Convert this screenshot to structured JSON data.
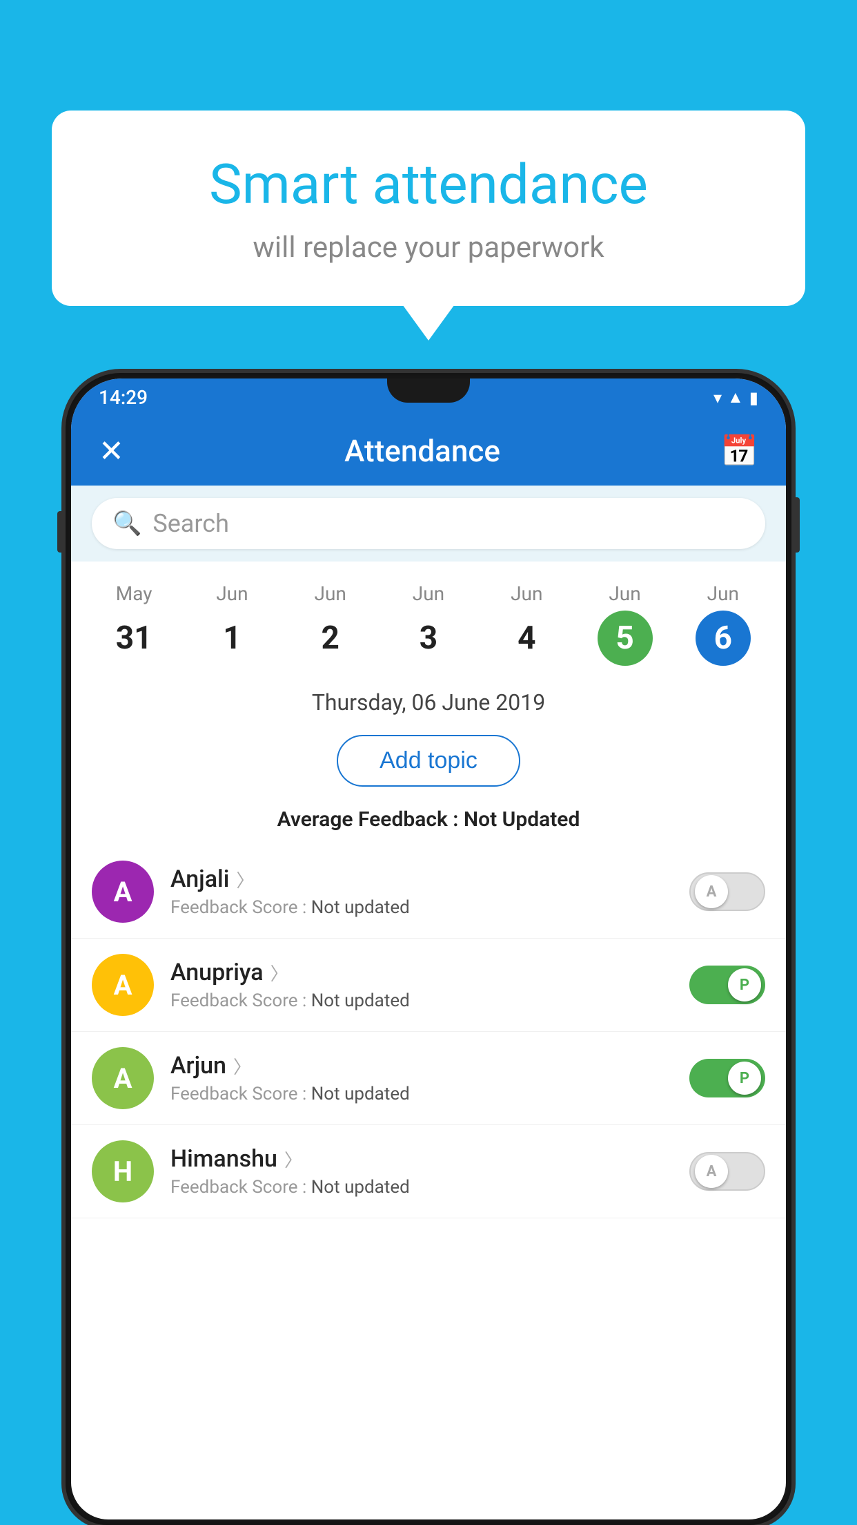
{
  "background_color": "#1ab6e8",
  "bubble": {
    "title": "Smart attendance",
    "subtitle": "will replace your paperwork"
  },
  "status_bar": {
    "time": "14:29"
  },
  "app_bar": {
    "title": "Attendance",
    "close_icon": "✕",
    "calendar_icon": "📅"
  },
  "search": {
    "placeholder": "Search"
  },
  "calendar": {
    "days": [
      {
        "month": "May",
        "num": "31",
        "state": "normal"
      },
      {
        "month": "Jun",
        "num": "1",
        "state": "normal"
      },
      {
        "month": "Jun",
        "num": "2",
        "state": "normal"
      },
      {
        "month": "Jun",
        "num": "3",
        "state": "normal"
      },
      {
        "month": "Jun",
        "num": "4",
        "state": "normal"
      },
      {
        "month": "Jun",
        "num": "5",
        "state": "today"
      },
      {
        "month": "Jun",
        "num": "6",
        "state": "selected"
      }
    ]
  },
  "selected_date": "Thursday, 06 June 2019",
  "add_topic_label": "Add topic",
  "average_feedback": {
    "label": "Average Feedback : ",
    "value": "Not Updated"
  },
  "students": [
    {
      "name": "Anjali",
      "avatar_letter": "A",
      "avatar_color": "#9c27b0",
      "feedback": "Not updated",
      "toggle_state": "off",
      "toggle_label": "A"
    },
    {
      "name": "Anupriya",
      "avatar_letter": "A",
      "avatar_color": "#ffc107",
      "feedback": "Not updated",
      "toggle_state": "on",
      "toggle_label": "P"
    },
    {
      "name": "Arjun",
      "avatar_letter": "A",
      "avatar_color": "#8bc34a",
      "feedback": "Not updated",
      "toggle_state": "on",
      "toggle_label": "P"
    },
    {
      "name": "Himanshu",
      "avatar_letter": "H",
      "avatar_color": "#8bc34a",
      "feedback": "Not updated",
      "toggle_state": "off",
      "toggle_label": "A"
    }
  ],
  "feedback_label": "Feedback Score : "
}
